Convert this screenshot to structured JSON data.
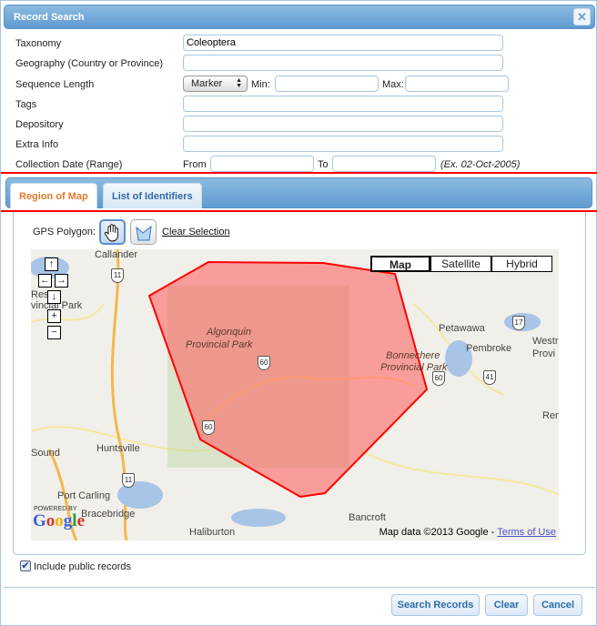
{
  "dialog": {
    "title": "Record Search",
    "close_icon": "close-icon"
  },
  "form": {
    "taxonomy": {
      "label": "Taxonomy",
      "value": "Coleoptera"
    },
    "geography": {
      "label": "Geography (Country or Province)",
      "value": ""
    },
    "sequence_length": {
      "label": "Sequence Length",
      "select_value": "Marker",
      "min_label": "Min:",
      "max_label": "Max:",
      "min_value": "",
      "max_value": ""
    },
    "tags": {
      "label": "Tags",
      "value": ""
    },
    "depository": {
      "label": "Depository",
      "value": ""
    },
    "extra_info": {
      "label": "Extra Info",
      "value": ""
    },
    "collection_date": {
      "label": "Collection Date (Range)",
      "from_label": "From",
      "to_label": "To",
      "from_value": "",
      "to_value": "",
      "hint": "(Ex. 02-Oct-2005)"
    }
  },
  "tabs": [
    {
      "label": "Region of Map",
      "active": true
    },
    {
      "label": "List of Identifiers",
      "active": false
    }
  ],
  "gps": {
    "label": "GPS Polygon:",
    "tools": [
      "hand-icon",
      "polygon-icon"
    ],
    "clear_label": "Clear Selection"
  },
  "map": {
    "types": [
      "Map",
      "Satellite",
      "Hybrid"
    ],
    "selected_type": "Map",
    "nav": {
      "up": "↑",
      "left": "←",
      "right": "→",
      "down": "↓",
      "zoom_in": "+",
      "zoom_out": "−"
    },
    "places": [
      "Callander",
      "Algonquin",
      "Provincial Park",
      "Bonnechere",
      "Provincial Park",
      "Petawawa",
      "Pembroke",
      "Huntsville",
      "Port Carling",
      "Bracebridge",
      "Haliburton",
      "Bancroft",
      "Sound",
      "Westr",
      "Provi",
      "Res",
      "vincial Park",
      "Ren"
    ],
    "shields": [
      "11",
      "11",
      "60",
      "60",
      "60",
      "17",
      "41"
    ],
    "polygon_color": "#ff0000",
    "powered_by": "POWERED BY",
    "logo": "Google",
    "copyright": "Map data ©2013 Google - ",
    "terms": "Terms of Use"
  },
  "include_public": {
    "label": "Include public records",
    "checked": true
  },
  "buttons": {
    "search": "Search Records",
    "clear": "Clear",
    "cancel": "Cancel"
  },
  "colors": {
    "accent": "#5f9bd0",
    "active_tab": "#e5792a",
    "button_text": "#2d6ca8"
  }
}
